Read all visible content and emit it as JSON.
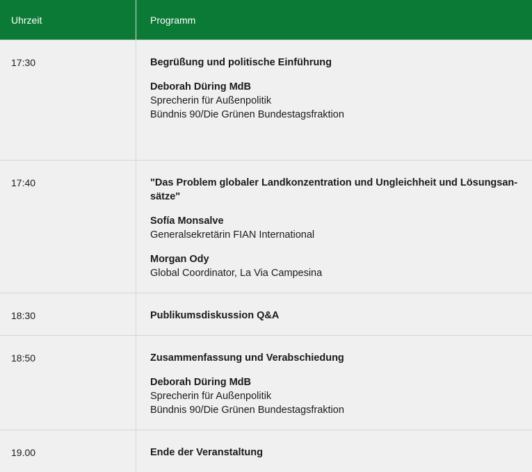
{
  "header": {
    "time_label": "Uhrzeit",
    "program_label": "Programm"
  },
  "rows": [
    {
      "time": "17:30",
      "title": "Begrüßung und politische Einführung",
      "persons": [
        {
          "name": "Deborah Düring MdB",
          "line1": "Sprecherin für Außenpolitik",
          "line2": "Bündnis 90/Die Grünen Bundestagsfraktion"
        }
      ]
    },
    {
      "time": "17:40",
      "title": "\"Das Problem globaler Landkonzentration und Ungleichheit und Lösungsan-sätze\"",
      "persons": [
        {
          "name": "Sofía Monsalve",
          "line1": "Generalsekretärin FIAN International"
        },
        {
          "name": "Morgan Ody",
          "line1": "Global Coordinator, La Via Campesina"
        }
      ]
    },
    {
      "time": "18:30",
      "title": "Publikumsdiskussion Q&A"
    },
    {
      "time": "18:50",
      "title": "Zusammenfassung und Verabschiedung",
      "persons": [
        {
          "name": "Deborah Düring MdB",
          "line1": "Sprecherin für Außenpolitik",
          "line2": "Bündnis 90/Die Grünen Bundestagsfraktion"
        }
      ]
    },
    {
      "time": "19.00",
      "title": "Ende der Veranstaltung"
    }
  ]
}
